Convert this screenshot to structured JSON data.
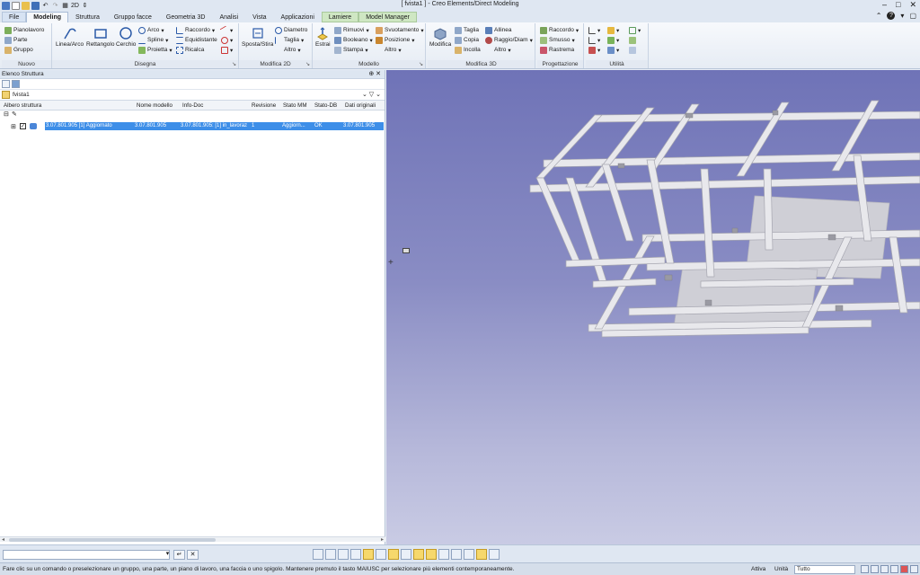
{
  "window": {
    "title": "[ fvista1 ] - Creo Elements/Direct Modeling",
    "qat_view_mode": "2D"
  },
  "tabs": [
    "File",
    "Modeling",
    "Struttura",
    "Gruppo facce",
    "Geometria 3D",
    "Analisi",
    "Vista",
    "Applicazioni",
    "Lamiere",
    "Model Manager"
  ],
  "ribbon": {
    "nuovo": {
      "label": "Nuovo",
      "items": [
        "Pianolavoro",
        "Parte",
        "Gruppo"
      ]
    },
    "disegna": {
      "label": "Disegna",
      "big": [
        "Linea/Arco",
        "Rettangolo",
        "Cerchio"
      ],
      "small": [
        "Arco",
        "Spline",
        "Proietta",
        "Raccordo",
        "Equidistante",
        "Ricalca"
      ]
    },
    "modifica2d": {
      "label": "Modifica 2D",
      "big": "Sposta/Stira",
      "small": [
        "Diametro",
        "Taglia",
        "Altro"
      ]
    },
    "modello": {
      "label": "Modello",
      "big": "Estrai",
      "small": [
        "Rimuovi",
        "Booleano",
        "Stampa",
        "Svuotamento",
        "Posizione",
        "Altro"
      ]
    },
    "modifica3d": {
      "label": "Modifica 3D",
      "big": "Modifica",
      "small": [
        "Taglia",
        "Copia",
        "Incolla",
        "Allinea",
        "Raggio/Diam",
        "Altro"
      ]
    },
    "progettazione": {
      "label": "Progettazione",
      "small": [
        "Raccordo",
        "Smusso",
        "Rastrema"
      ]
    },
    "utilita": {
      "label": "Utilità"
    }
  },
  "panel": {
    "title": "Elenco Struttura",
    "view_name": "fvista1",
    "columns": [
      "Albero struttura",
      "Nome modello",
      "Info-Doc",
      "Revisione",
      "Stato MM",
      "Stato-DB",
      "Dati originali"
    ],
    "row": {
      "name": "3.07.801.905 [1] Aggiornato",
      "model": "3.07.801.905",
      "info": "3.07.801.905: [1] in_lavoraz",
      "rev": "1",
      "mm": "Aggiorn...",
      "db": "OK",
      "orig": "3.07.801.905"
    }
  },
  "statusbar": {
    "message": "Fare clic su un comando o preselezionare un gruppo, una parte, un piano di lavoro, una faccia o uno spigolo. Mantenere premuto il tasto MAIUSC per selezionare più elementi contemporaneamente.",
    "active_label": "Attiva",
    "unit_label": "Unità",
    "filter_value": "Tutto"
  },
  "colors": {
    "viewport_top": "#6f73b7",
    "viewport_bottom": "#c9cbe4",
    "selection": "#3d8ee8",
    "frame": "#e6e6ea"
  }
}
